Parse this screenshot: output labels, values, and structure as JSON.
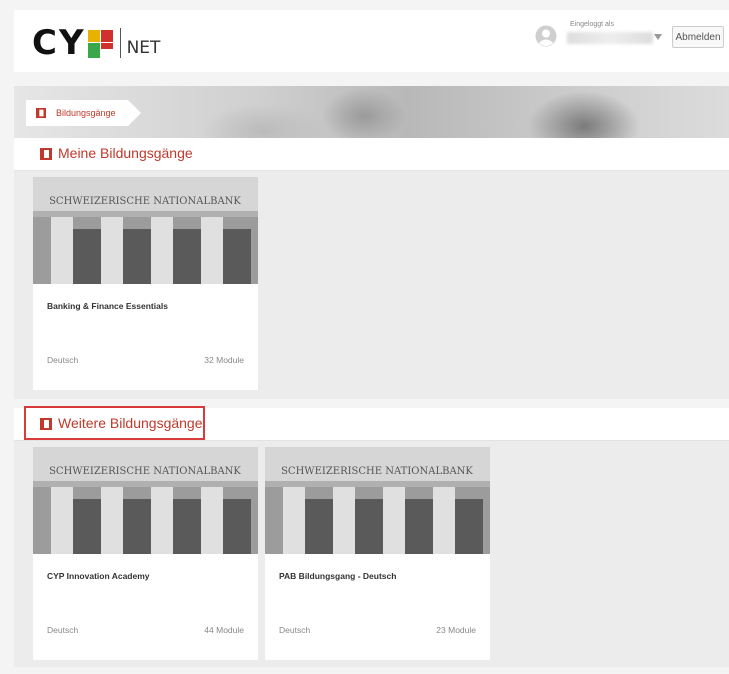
{
  "header": {
    "logo_letters": "CY",
    "logo_suffix": "NET",
    "user_label": "Eingeloggt als",
    "logout_label": "Abmelden"
  },
  "breadcrumb": {
    "label": "Bildungsgänge"
  },
  "sections": [
    {
      "title": "Meine Bildungsgänge",
      "courses": [
        {
          "title": "Banking & Finance Essentials",
          "language": "Deutsch",
          "modules": "32 Module"
        }
      ]
    },
    {
      "title": "Weitere Bildungsgänge",
      "courses": [
        {
          "title": "CYP Innovation Academy",
          "language": "Deutsch",
          "modules": "44 Module"
        },
        {
          "title": "PAB Bildungsgang - Deutsch",
          "language": "Deutsch",
          "modules": "23 Module"
        }
      ]
    }
  ],
  "card_image_text": "SCHWEIZERISCHE NATIONALBANK",
  "colors": {
    "accent": "#c0392b",
    "highlight": "#d93a3a"
  }
}
